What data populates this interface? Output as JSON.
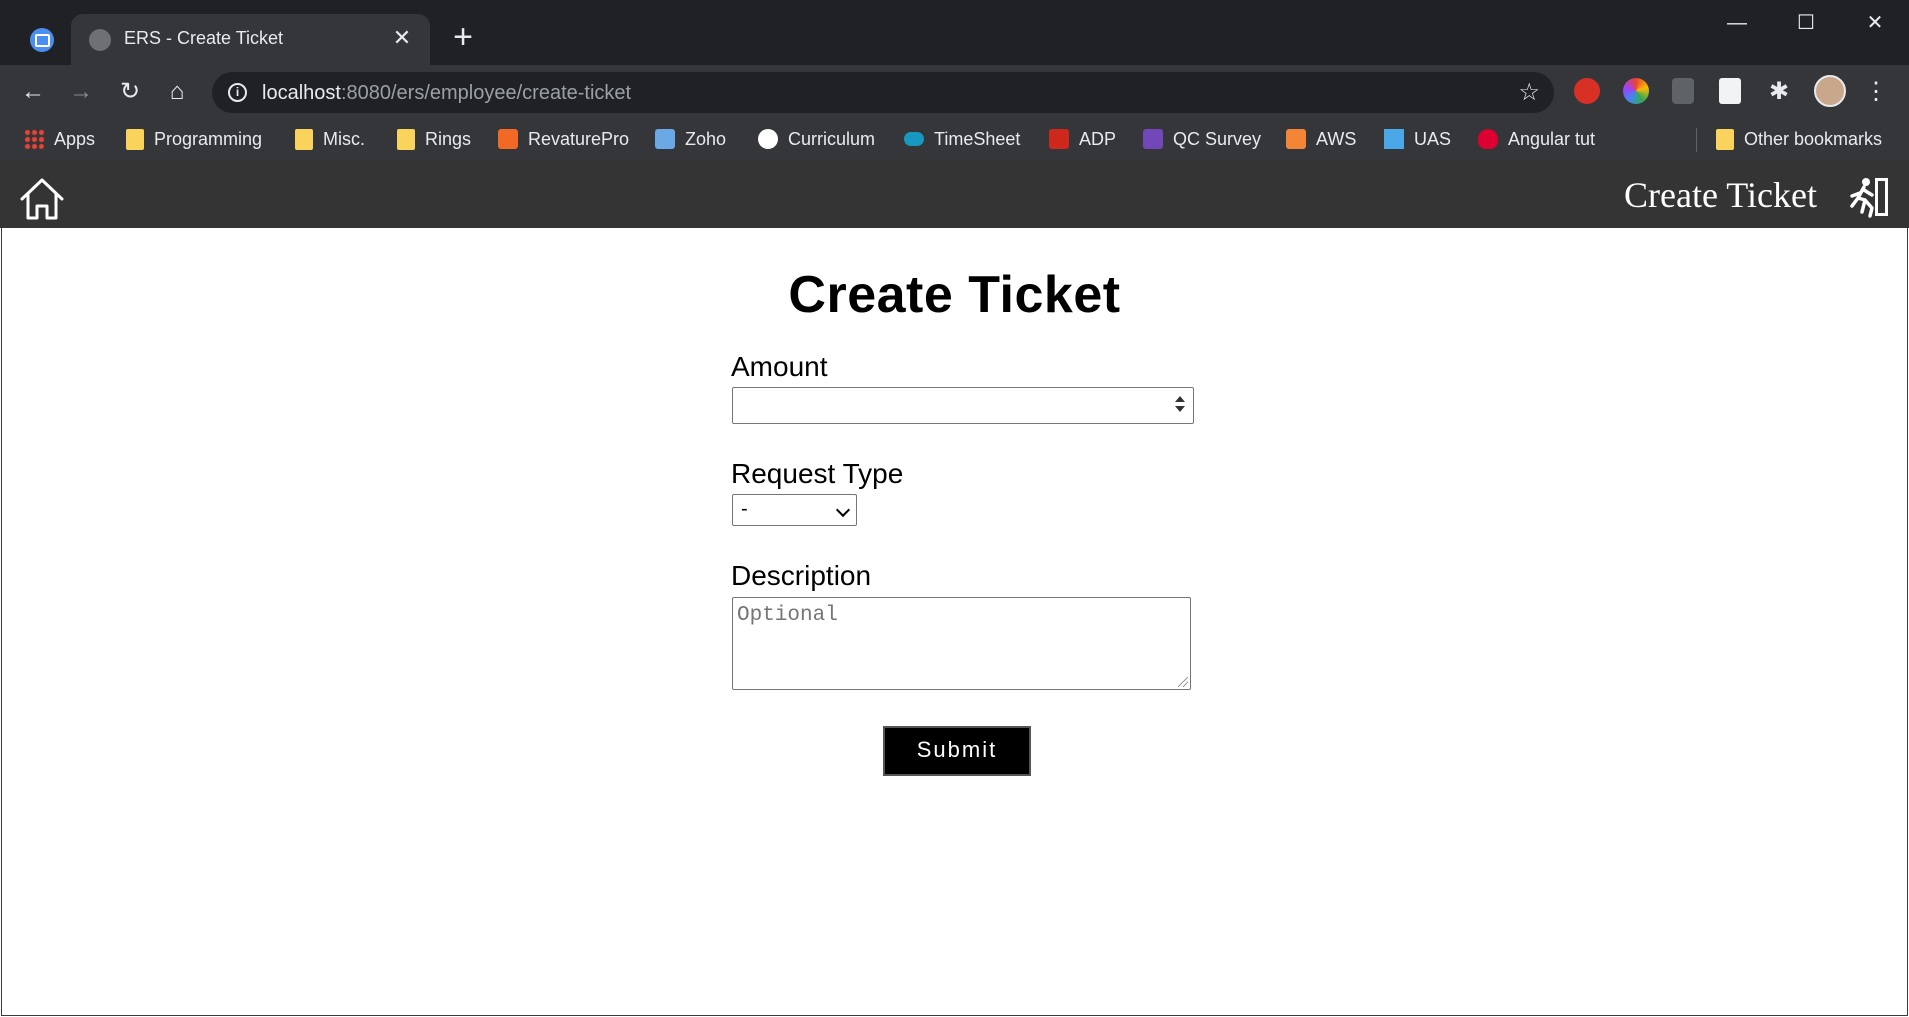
{
  "browser": {
    "tab_title": "ERS - Create Ticket",
    "url_host": "localhost",
    "url_path": ":8080/ers/employee/create-ticket",
    "window_controls": [
      "minimize",
      "maximize",
      "close"
    ]
  },
  "bookmarks": [
    {
      "label": "Apps",
      "icon": "apps-grid-icon",
      "color": "#ea4335"
    },
    {
      "label": "Programming",
      "icon": "folder-icon",
      "color": "#f9d35c"
    },
    {
      "label": "Misc.",
      "icon": "folder-icon",
      "color": "#f9d35c"
    },
    {
      "label": "Rings",
      "icon": "folder-icon",
      "color": "#f9d35c"
    },
    {
      "label": "RevaturePro",
      "icon": "revature-icon",
      "color": "#f26925"
    },
    {
      "label": "Zoho",
      "icon": "zoho-icon",
      "color": "#6aa8e6"
    },
    {
      "label": "Curriculum",
      "icon": "github-icon",
      "color": "#ffffff"
    },
    {
      "label": "TimeSheet",
      "icon": "salesforce-cloud-icon",
      "color": "#1798c1"
    },
    {
      "label": "ADP",
      "icon": "adp-icon",
      "color": "#d0271d"
    },
    {
      "label": "QC Survey",
      "icon": "list-icon",
      "color": "#7248b9"
    },
    {
      "label": "AWS",
      "icon": "aws-cube-icon",
      "color": "#f58536"
    },
    {
      "label": "UAS",
      "icon": "uas-icon",
      "color": "#4aa8e8"
    },
    {
      "label": "Angular tut",
      "icon": "angular-icon",
      "color": "#dd0031"
    }
  ],
  "other_bookmarks": "Other bookmarks",
  "header": {
    "title": "Create Ticket"
  },
  "form": {
    "heading": "Create Ticket",
    "amount_label": "Amount",
    "amount_value": "",
    "request_type_label": "Request Type",
    "request_type_value": "-",
    "description_label": "Description",
    "description_placeholder": "Optional",
    "submit_label": "Submit"
  }
}
